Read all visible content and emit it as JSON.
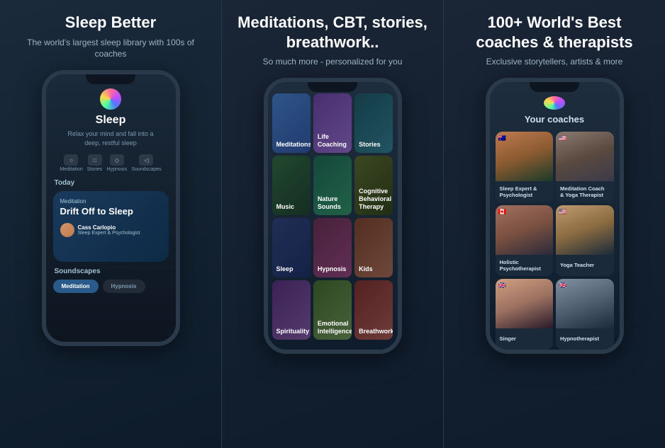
{
  "panels": [
    {
      "id": "panel-1",
      "header": {
        "title": "Sleep Better",
        "subtitle": "The world's largest sleep library with 100s of coaches"
      },
      "phone": {
        "sleep_title": "Sleep",
        "sleep_subtitle": "Relax your mind and fall into a deep, restful sleep",
        "nav_tabs": [
          "Meditation",
          "Stories",
          "Hypnosis",
          "Soundscapes"
        ],
        "today_label": "Today",
        "card_type": "Meditation",
        "card_title": "Drift Off to Sleep",
        "coach_name": "Cass Carlopio",
        "coach_role": "Sleep Expert & Psychologist",
        "soundscapes_label": "Soundscapes",
        "soundscape_tabs": [
          "Meditation",
          "Hypnosis"
        ]
      }
    },
    {
      "id": "panel-2",
      "header": {
        "title": "Meditations, CBT, stories, breathwork..",
        "subtitle": "So much more - personalized for you"
      },
      "phone": {
        "grid_items": [
          {
            "label": "Meditations",
            "class": "gi-meditations"
          },
          {
            "label": "Life Coaching",
            "class": "gi-lifecoaching"
          },
          {
            "label": "Stories",
            "class": "gi-stories"
          },
          {
            "label": "Music",
            "class": "gi-music"
          },
          {
            "label": "Nature Sounds",
            "class": "gi-naturesounds"
          },
          {
            "label": "Cognitive Behavioral Therapy",
            "class": "gi-cbt"
          },
          {
            "label": "Sleep",
            "class": "gi-sleep"
          },
          {
            "label": "Hypnosis",
            "class": "gi-hypnosis"
          },
          {
            "label": "Kids",
            "class": "gi-kids"
          },
          {
            "label": "Spirituality",
            "class": "gi-spirituality"
          },
          {
            "label": "Emotional Intelligence",
            "class": "gi-emotional"
          },
          {
            "label": "Breathwork",
            "class": "gi-breathwork"
          }
        ]
      }
    },
    {
      "id": "panel-3",
      "header": {
        "title": "100+ World's Best coaches & therapists",
        "subtitle": "Exclusive storytellers, artists & more"
      },
      "phone": {
        "coaches_label": "Your coaches",
        "coaches": [
          {
            "name": "Sleep Expert & Psychologist",
            "flag": "🇦🇺",
            "bg_class": "cp-1"
          },
          {
            "name": "Meditation Coach & Yoga Therapist",
            "flag": "🇺🇸",
            "bg_class": "cp-2"
          },
          {
            "name": "Holistic Psychotherapist",
            "flag": "🇨🇦",
            "bg_class": "cp-3"
          },
          {
            "name": "Yoga Teacher",
            "flag": "🇺🇸",
            "bg_class": "cp-4"
          },
          {
            "name": "Singer",
            "flag": "🇬🇧",
            "bg_class": "cp-5"
          },
          {
            "name": "Hypnotherapist",
            "flag": "🇬🇧",
            "bg_class": "cp-6"
          }
        ]
      }
    }
  ],
  "icons": {
    "meditation": "○",
    "stories": "□",
    "hypnosis": "◇",
    "soundscapes": "◁"
  }
}
